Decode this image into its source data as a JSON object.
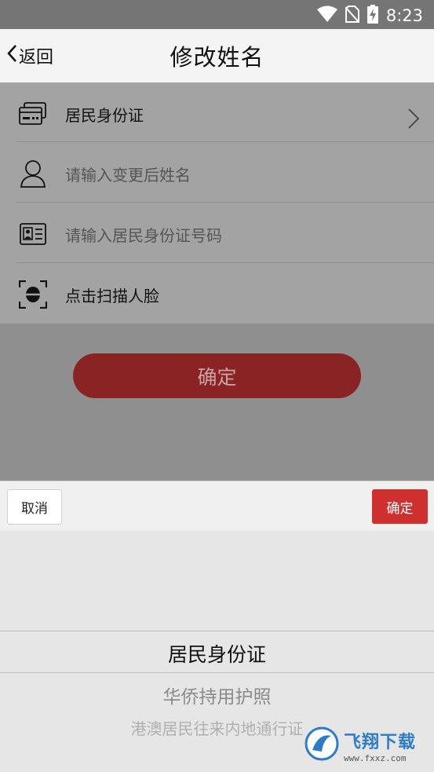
{
  "status_bar": {
    "time": "8:23"
  },
  "header": {
    "back_label": "返回",
    "title": "修改姓名"
  },
  "form": {
    "id_type": {
      "label": "居民身份证"
    },
    "name_input": {
      "placeholder": "请输入变更后姓名"
    },
    "id_number_input": {
      "placeholder": "请输入居民身份证号码"
    },
    "face_scan": {
      "label": "点击扫描人脸"
    }
  },
  "confirm_button": {
    "label": "确定"
  },
  "picker": {
    "cancel_label": "取消",
    "ok_label": "确定",
    "options": [
      "居民身份证",
      "华侨持用护照",
      "港澳居民往来内地通行证"
    ],
    "selected": "居民身份证"
  },
  "watermark": {
    "text": "飞翔下载",
    "url": "www.fxxz.com"
  },
  "colors": {
    "status_bar": "#757575",
    "confirm_bg": "#8a2324",
    "picker_ok": "#cf2f2f",
    "watermark_blue": "#2b7ccd"
  }
}
